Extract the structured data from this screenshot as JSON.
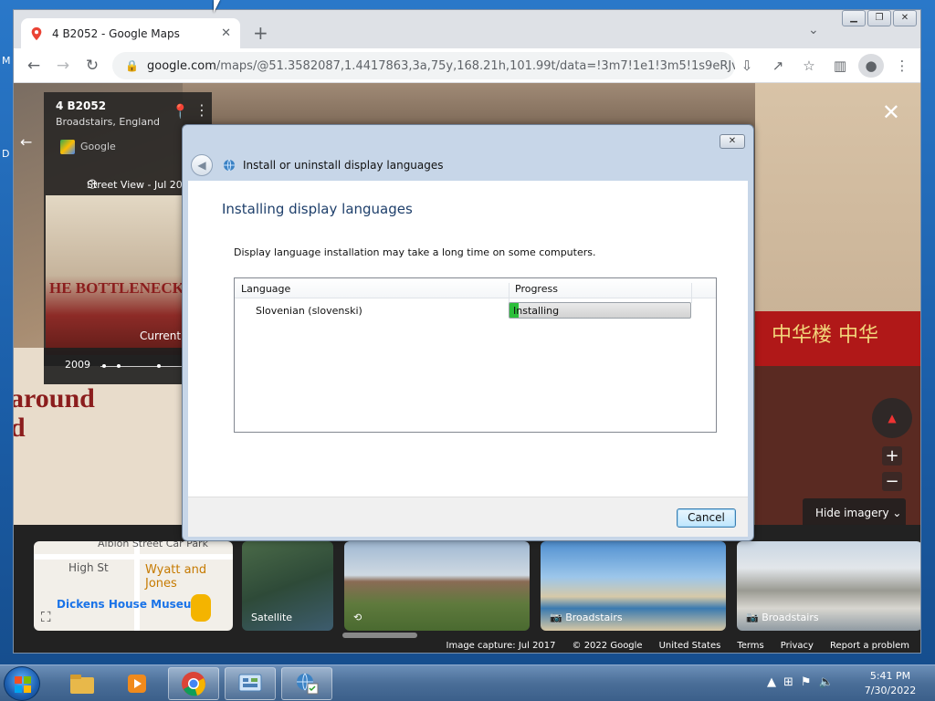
{
  "browser": {
    "tab_title": "4 B2052 - Google Maps",
    "tab_close": "✕",
    "new_tab": "+",
    "url_host": "google.com",
    "url_path": "/maps/@51.3582087,1.4417863,3a,75y,168.21h,101.99t/data=!3m7!1e1!3m5!1s9eRJvXhr_p...",
    "window_buttons": [
      "▁",
      "❐",
      "✕"
    ]
  },
  "map": {
    "address": "4 B2052",
    "city": "Broadstairs, England",
    "provider": "Google",
    "street_view_date": "Street View - Jul 2017",
    "currently_label": "Currently",
    "timeline_year": "2009",
    "bottle_sign": "HE BOTTLENECK",
    "around_text": "around\nd",
    "shop_sign": "中华楼  中华",
    "hide_imagery": "Hide imagery",
    "thumbnails": [
      {
        "caption": ""
      },
      {
        "caption": "Satellite"
      },
      {
        "caption": ""
      },
      {
        "caption": "Broadstairs"
      },
      {
        "caption": "Broadstairs"
      }
    ],
    "map_thumb": {
      "street1": "Albion Street Car Park",
      "street2": "High St",
      "place1": "Wyatt and Jones",
      "place2": "Dickens House Museum"
    },
    "footer": [
      "Image capture: Jul 2017",
      "© 2022 Google",
      "United States",
      "Terms",
      "Privacy",
      "Report a problem"
    ]
  },
  "dialog": {
    "title": "Install or uninstall display languages",
    "heading": "Installing display languages",
    "description": "Display language installation may take a long time on some computers.",
    "columns": [
      "Language",
      "Progress"
    ],
    "rows": [
      {
        "language": "Slovenian (slovenski)",
        "status": "Installing",
        "progress": 0.05
      }
    ],
    "cancel_label": "Cancel"
  },
  "taskbar": {
    "time": "5:41 PM",
    "date": "7/30/2022"
  },
  "colors": {
    "progress_fill": "#2cbf3a",
    "dialog_heading": "#1e3f6b"
  }
}
